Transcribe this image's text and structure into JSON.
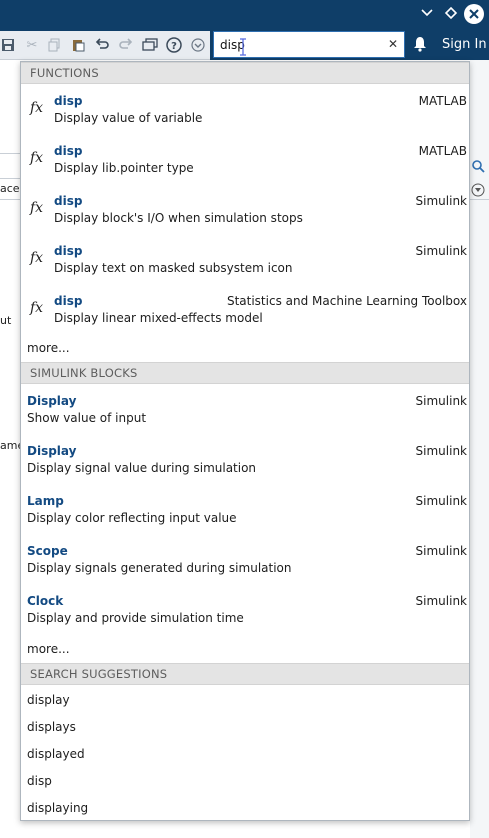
{
  "titlebar": {
    "controls": [
      "chevron-down",
      "diamond",
      "close"
    ]
  },
  "toolbar": {
    "icons": [
      "save-icon",
      "cut-icon",
      "copy-icon",
      "paste-icon",
      "undo-icon",
      "redo-icon",
      "switch-windows-icon",
      "help-icon",
      "customize-icon"
    ]
  },
  "search": {
    "value": "disp",
    "clear_glyph": "✕"
  },
  "header_right": {
    "sign_in_label": "Sign In"
  },
  "background": {
    "fragments": [
      "ace",
      "ut",
      "ame"
    ]
  },
  "dropdown": {
    "functions": {
      "header": "FUNCTIONS",
      "icon_label": "fx",
      "items": [
        {
          "name": "disp",
          "description": "Display value of variable",
          "source": "MATLAB"
        },
        {
          "name": "disp",
          "description": "Display lib.pointer type",
          "source": "MATLAB"
        },
        {
          "name": "disp",
          "description": "Display block's I/O when simulation stops",
          "source": "Simulink"
        },
        {
          "name": "disp",
          "description": "Display text on masked subsystem icon",
          "source": "Simulink"
        },
        {
          "name": "disp",
          "description": "Display linear mixed-effects model",
          "source": "Statistics and Machine Learning Toolbox"
        }
      ],
      "more_label": "more..."
    },
    "simulink_blocks": {
      "header": "SIMULINK BLOCKS",
      "items": [
        {
          "name": "Display",
          "description": "Show value of input",
          "source": "Simulink"
        },
        {
          "name": "Display",
          "description": "Display signal value during simulation",
          "source": "Simulink"
        },
        {
          "name": "Lamp",
          "description": "Display color reflecting input value",
          "source": "Simulink"
        },
        {
          "name": "Scope",
          "description": "Display signals generated during simulation",
          "source": "Simulink"
        },
        {
          "name": "Clock",
          "description": "Display and provide simulation time",
          "source": "Simulink"
        }
      ],
      "more_label": "more..."
    },
    "suggestions": {
      "header": "SEARCH SUGGESTIONS",
      "items": [
        "display",
        "displays",
        "displayed",
        "disp",
        "displaying"
      ]
    }
  },
  "colors": {
    "titlebar_bg": "#0f3e68",
    "item_name": "#134a82",
    "section_header_bg": "#e4e4e4"
  }
}
